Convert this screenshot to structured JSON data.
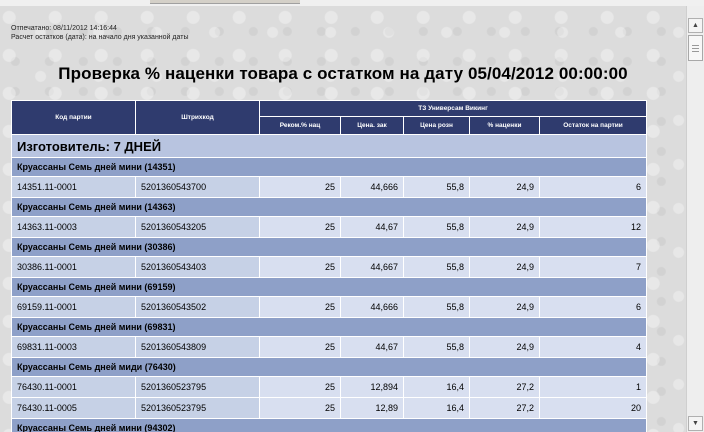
{
  "meta": {
    "printed": "Отпечатано: 08/11/2012 14:16:44",
    "calc": "Расчет остатков (дата): на начало дня указанной даты"
  },
  "title": "Проверка % наценки товара с остатком на дату 05/04/2012 00:00:00",
  "table": {
    "headers": {
      "party_code": "Код партии",
      "barcode": "Штрихкод",
      "store": "ТЗ Универсам Викинг",
      "sub": [
        "Реком.% нац",
        "Цена. зак",
        "Цена розн",
        "% наценки",
        "Остаток на партии"
      ]
    },
    "manufacturer": "Изготовитель: 7 ДНЕЙ",
    "groups": [
      {
        "name": "Круассаны Семь дней мини (14351)",
        "rows": [
          [
            "14351.11-0001",
            "5201360543700",
            "25",
            "44,666",
            "55,8",
            "24,9",
            "6"
          ]
        ]
      },
      {
        "name": "Круассаны Семь дней мини (14363)",
        "rows": [
          [
            "14363.11-0003",
            "5201360543205",
            "25",
            "44,67",
            "55,8",
            "24,9",
            "12"
          ]
        ]
      },
      {
        "name": "Круассаны Семь дней мини (30386)",
        "rows": [
          [
            "30386.11-0001",
            "5201360543403",
            "25",
            "44,667",
            "55,8",
            "24,9",
            "7"
          ]
        ]
      },
      {
        "name": "Круассаны Семь дней мини (69159)",
        "rows": [
          [
            "69159.11-0001",
            "5201360543502",
            "25",
            "44,666",
            "55,8",
            "24,9",
            "6"
          ]
        ]
      },
      {
        "name": "Круассаны Семь дней мини (69831)",
        "rows": [
          [
            "69831.11-0003",
            "5201360543809",
            "25",
            "44,67",
            "55,8",
            "24,9",
            "4"
          ]
        ]
      },
      {
        "name": "Круассаны Семь дней миди (76430)",
        "rows": [
          [
            "76430.11-0001",
            "5201360523795",
            "25",
            "12,894",
            "16,4",
            "27,2",
            "1"
          ],
          [
            "76430.11-0005",
            "5201360523795",
            "25",
            "12,89",
            "16,4",
            "27,2",
            "20"
          ]
        ]
      },
      {
        "name": "Круассаны Семь дней мини (94302)",
        "rows": []
      }
    ]
  },
  "scrollbar": {
    "up_icon": "arrow-up-icon",
    "down_icon": "arrow-down-icon"
  }
}
